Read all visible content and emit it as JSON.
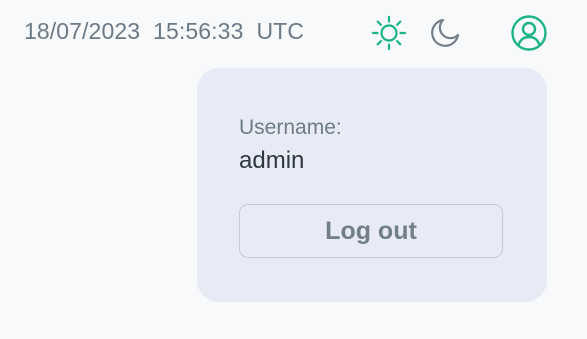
{
  "header": {
    "date": "18/07/2023",
    "time": "15:56:33",
    "timezone": "UTC",
    "theme_light_icon": "sun-icon",
    "theme_dark_icon": "moon-icon",
    "account_icon": "user-circle-icon"
  },
  "account_menu": {
    "username_label": "Username:",
    "username_value": "admin",
    "logout_label": "Log out"
  },
  "colors": {
    "accent": "#1db388",
    "muted_text": "#6b7a86",
    "popup_background": "#e8ebf5",
    "page_background": "#f8f9fa"
  }
}
